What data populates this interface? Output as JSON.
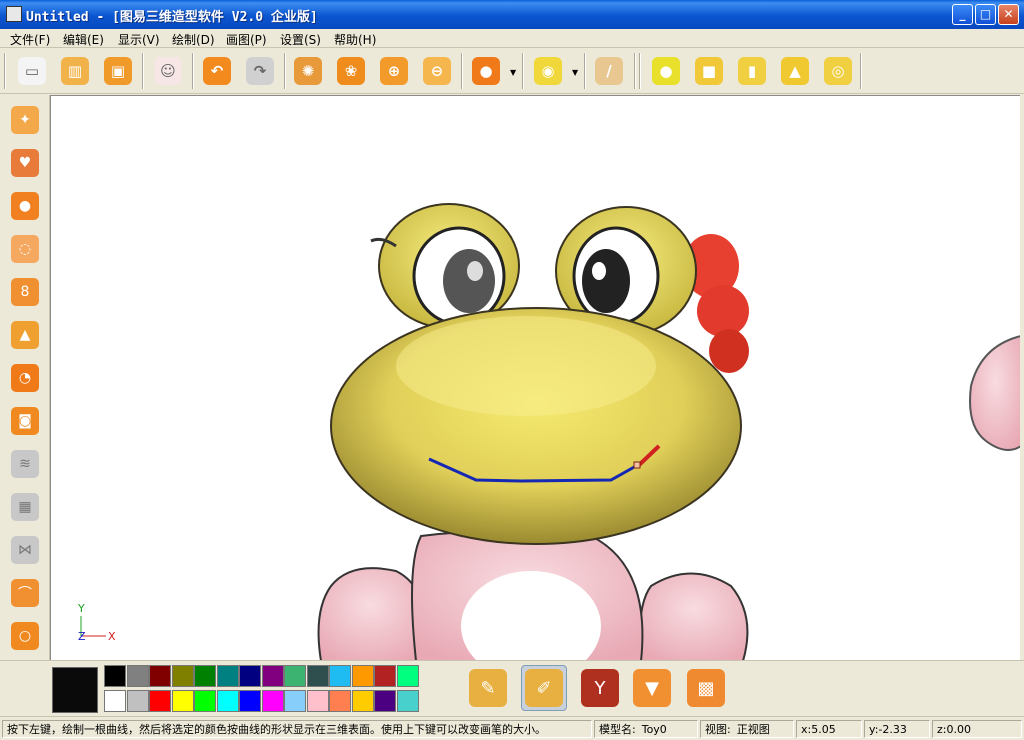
{
  "window": {
    "title": "Untitled - [图易三维造型软件 V2.0 企业版]",
    "minimize": "_",
    "maximize": "□",
    "close": "✕"
  },
  "menu": [
    "文件(F)",
    "编辑(E)",
    "显示(V)",
    "绘制(D)",
    "画图(P)",
    "设置(S)",
    "帮助(H)"
  ],
  "toolbar": {
    "items": [
      {
        "name": "new-document-icon",
        "color": "#f4f4f4",
        "glyph": "▭"
      },
      {
        "name": "open-book-icon",
        "color": "#f2b24a",
        "glyph": "▥"
      },
      {
        "name": "save-box-icon",
        "color": "#f09a2a",
        "glyph": "▣"
      },
      {
        "name": "bear-portrait-icon",
        "color": "#f6e6e6",
        "glyph": "☺"
      },
      {
        "name": "undo-icon",
        "color": "#f28a1e",
        "glyph": "↶"
      },
      {
        "name": "redo-icon",
        "color": "#d0d0d0",
        "glyph": "↷"
      },
      {
        "name": "rotate-pinwheel-icon",
        "color": "#e89a3a",
        "glyph": "✺"
      },
      {
        "name": "paw-pan-icon",
        "color": "#f08c1c",
        "glyph": "❀"
      },
      {
        "name": "zoom-in-icon",
        "color": "#f29a2a",
        "glyph": "⊕"
      },
      {
        "name": "zoom-out-icon",
        "color": "#f6b64e",
        "glyph": "⊖"
      },
      {
        "name": "render-sphere-icon",
        "color": "#f07a1a",
        "glyph": "●"
      },
      {
        "name": "eyes-view-icon",
        "color": "#f0d83a",
        "glyph": "◉"
      },
      {
        "name": "ruler-icon",
        "color": "#e8c890",
        "glyph": "/"
      },
      {
        "name": "sphere-primitive-icon",
        "color": "#e8e02a",
        "glyph": "●"
      },
      {
        "name": "cube-primitive-icon",
        "color": "#f0c838",
        "glyph": "■"
      },
      {
        "name": "cylinder-primitive-icon",
        "color": "#f0d040",
        "glyph": "▮"
      },
      {
        "name": "cone-primitive-icon",
        "color": "#f0c830",
        "glyph": "▲"
      },
      {
        "name": "torus-primitive-icon",
        "color": "#f0d040",
        "glyph": "◎"
      }
    ]
  },
  "left_tools": [
    {
      "name": "magic-wand-icon",
      "color": "#f3a94a",
      "glyph": "✦"
    },
    {
      "name": "heart-lollipop-icon",
      "color": "#e87a3a",
      "glyph": "♥"
    },
    {
      "name": "ellipse-blob-icon",
      "color": "#f08020",
      "glyph": "●"
    },
    {
      "name": "dotted-lasso-icon",
      "color": "#f4a860",
      "glyph": "◌"
    },
    {
      "name": "gourd-shape-icon",
      "color": "#f09030",
      "glyph": "8"
    },
    {
      "name": "bell-shape-icon",
      "color": "#f0a030",
      "glyph": "▲"
    },
    {
      "name": "pie-shape-icon",
      "color": "#f07a18",
      "glyph": "◔"
    },
    {
      "name": "button-shape-icon",
      "color": "#f08a20",
      "glyph": "◙"
    },
    {
      "name": "wave-stroke-icon",
      "color": "#c8c8c8",
      "glyph": "≋"
    },
    {
      "name": "mesh-grid-icon",
      "color": "#c8c8c8",
      "glyph": "▦"
    },
    {
      "name": "butterfly-mirror-icon",
      "color": "#c8c8c8",
      "glyph": "⋈"
    },
    {
      "name": "bone-path-icon",
      "color": "#f09030",
      "glyph": "⌒"
    },
    {
      "name": "dotted-circle-icon",
      "color": "#f08a20",
      "glyph": "○"
    }
  ],
  "palette": {
    "current": "#0a0a0a",
    "row1": [
      "#000000",
      "#808080",
      "#800000",
      "#808000",
      "#008000",
      "#008080",
      "#000080",
      "#800080",
      "#3cb371",
      "#2f4f4f",
      "#1ebcf0",
      "#ff9900",
      "#b22222",
      "#00ff7f"
    ],
    "row2": [
      "#ffffff",
      "#c0c0c0",
      "#ff0000",
      "#ffff00",
      "#00ff00",
      "#00ffff",
      "#0000ff",
      "#ff00ff",
      "#87cefa",
      "#ffc0cb",
      "#ff7f50",
      "#ffcc00",
      "#4b0082",
      "#48d1cc"
    ],
    "brush_tools": [
      {
        "name": "brush-paint-icon",
        "color": "#e8b040",
        "glyph": "✎"
      },
      {
        "name": "brush-curve-icon",
        "color": "#e8b040",
        "glyph": "✐"
      },
      {
        "name": "wine-glass-icon",
        "color": "#b03020",
        "glyph": "Y"
      },
      {
        "name": "ice-cream-icon",
        "color": "#f09030",
        "glyph": "▼"
      },
      {
        "name": "checker-texture-icon",
        "color": "#f08a30",
        "glyph": "▩"
      }
    ]
  },
  "status": {
    "hint": "按下左键，绘制一根曲线，然后将选定的颜色按曲线的形状显示在三维表面。使用上下键可以改变画笔的大小。",
    "model_label": "模型名:",
    "model_name": "Toy0",
    "view_label": "视图:",
    "view_name": "正视图",
    "x": "x:5.05",
    "y": "y:-2.33",
    "z": "z:0.00"
  },
  "axes": {
    "y": "Y",
    "z": "Z",
    "x": "X"
  }
}
